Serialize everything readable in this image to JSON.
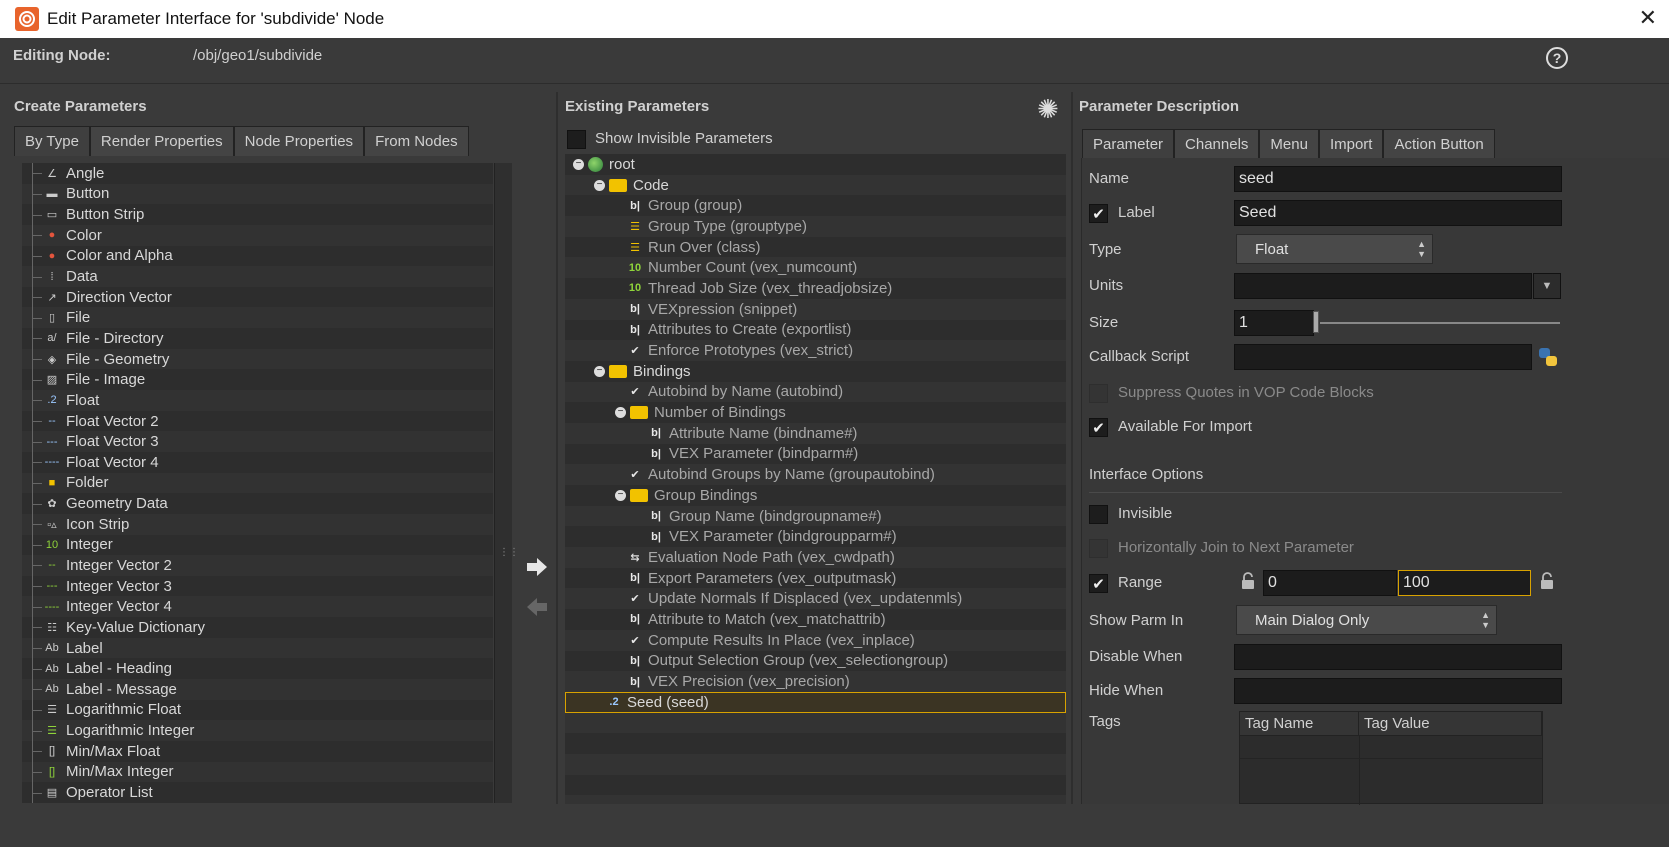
{
  "window": {
    "title": "Edit Parameter Interface for 'subdivide' Node"
  },
  "topbar": {
    "editing_label": "Editing Node:",
    "node_path": "/obj/geo1/subdivide"
  },
  "create": {
    "title": "Create Parameters",
    "tabs": [
      "By Type",
      "Render Properties",
      "Node Properties",
      "From Nodes"
    ],
    "items": [
      {
        "label": "Angle",
        "icon": "angle-icon"
      },
      {
        "label": "Button",
        "icon": "button-icon"
      },
      {
        "label": "Button Strip",
        "icon": "button-strip-icon"
      },
      {
        "label": "Color",
        "icon": "color-icon"
      },
      {
        "label": "Color and Alpha",
        "icon": "color-alpha-icon"
      },
      {
        "label": "Data",
        "icon": "data-icon"
      },
      {
        "label": "Direction Vector",
        "icon": "direction-icon"
      },
      {
        "label": "File",
        "icon": "file-icon"
      },
      {
        "label": "File - Directory",
        "icon": "directory-icon"
      },
      {
        "label": "File - Geometry",
        "icon": "geometry-file-icon"
      },
      {
        "label": "File - Image",
        "icon": "image-file-icon"
      },
      {
        "label": "Float",
        "icon": "float-icon"
      },
      {
        "label": "Float Vector 2",
        "icon": "vector2-icon"
      },
      {
        "label": "Float Vector 3",
        "icon": "vector3-icon"
      },
      {
        "label": "Float Vector 4",
        "icon": "vector4-icon"
      },
      {
        "label": "Folder",
        "icon": "folder-icon"
      },
      {
        "label": "Geometry Data",
        "icon": "geometry-data-icon"
      },
      {
        "label": "Icon Strip",
        "icon": "icon-strip-icon"
      },
      {
        "label": "Integer",
        "icon": "integer-icon"
      },
      {
        "label": "Integer Vector 2",
        "icon": "int-vector2-icon"
      },
      {
        "label": "Integer Vector 3",
        "icon": "int-vector3-icon"
      },
      {
        "label": "Integer Vector 4",
        "icon": "int-vector4-icon"
      },
      {
        "label": "Key-Value Dictionary",
        "icon": "dictionary-icon"
      },
      {
        "label": "Label",
        "icon": "label-icon"
      },
      {
        "label": "Label - Heading",
        "icon": "label-heading-icon"
      },
      {
        "label": "Label - Message",
        "icon": "label-message-icon"
      },
      {
        "label": "Logarithmic Float",
        "icon": "log-float-icon"
      },
      {
        "label": "Logarithmic Integer",
        "icon": "log-integer-icon"
      },
      {
        "label": "Min/Max Float",
        "icon": "minmax-float-icon"
      },
      {
        "label": "Min/Max Integer",
        "icon": "minmax-integer-icon"
      },
      {
        "label": "Operator List",
        "icon": "operator-list-icon"
      }
    ]
  },
  "existing": {
    "title": "Existing Parameters",
    "show_invisible": "Show Invisible Parameters",
    "rows": [
      {
        "label": "root",
        "depth": 0,
        "kind": "root"
      },
      {
        "label": "Code",
        "depth": 1,
        "kind": "folder"
      },
      {
        "label": "Group (group)",
        "depth": 2,
        "kind": "string"
      },
      {
        "label": "Group Type (grouptype)",
        "depth": 2,
        "kind": "menu"
      },
      {
        "label": "Run Over (class)",
        "depth": 2,
        "kind": "menu"
      },
      {
        "label": "Number Count (vex_numcount)",
        "depth": 2,
        "kind": "int"
      },
      {
        "label": "Thread Job Size (vex_threadjobsize)",
        "depth": 2,
        "kind": "int"
      },
      {
        "label": "VEXpression (snippet)",
        "depth": 2,
        "kind": "string"
      },
      {
        "label": "Attributes to Create (exportlist)",
        "depth": 2,
        "kind": "string"
      },
      {
        "label": "Enforce Prototypes (vex_strict)",
        "depth": 2,
        "kind": "toggle"
      },
      {
        "label": "Bindings",
        "depth": 1,
        "kind": "folder"
      },
      {
        "label": "Autobind by Name (autobind)",
        "depth": 2,
        "kind": "toggle"
      },
      {
        "label": "Number of Bindings",
        "depth": 2,
        "kind": "folder"
      },
      {
        "label": "Attribute Name (bindname#)",
        "depth": 3,
        "kind": "string"
      },
      {
        "label": "VEX Parameter (bindparm#)",
        "depth": 3,
        "kind": "string"
      },
      {
        "label": "Autobind Groups by Name (groupautobind)",
        "depth": 2,
        "kind": "toggle"
      },
      {
        "label": "Group Bindings",
        "depth": 2,
        "kind": "folder"
      },
      {
        "label": "Group Name (bindgroupname#)",
        "depth": 3,
        "kind": "string"
      },
      {
        "label": "VEX Parameter (bindgroupparm#)",
        "depth": 3,
        "kind": "string"
      },
      {
        "label": "Evaluation Node Path (vex_cwdpath)",
        "depth": 2,
        "kind": "oppath"
      },
      {
        "label": "Export Parameters (vex_outputmask)",
        "depth": 2,
        "kind": "string"
      },
      {
        "label": "Update Normals If Displaced (vex_updatenmls)",
        "depth": 2,
        "kind": "toggle"
      },
      {
        "label": "Attribute to Match (vex_matchattrib)",
        "depth": 2,
        "kind": "string"
      },
      {
        "label": "Compute Results In Place (vex_inplace)",
        "depth": 2,
        "kind": "toggle"
      },
      {
        "label": "Output Selection Group (vex_selectiongroup)",
        "depth": 2,
        "kind": "string"
      },
      {
        "label": "VEX Precision (vex_precision)",
        "depth": 2,
        "kind": "string"
      },
      {
        "label": "Seed (seed)",
        "depth": 1,
        "kind": "float",
        "selected": true
      },
      {
        "label": "",
        "depth": 0,
        "kind": "empty"
      },
      {
        "label": "",
        "depth": 0,
        "kind": "empty"
      },
      {
        "label": "",
        "depth": 0,
        "kind": "empty"
      },
      {
        "label": "",
        "depth": 0,
        "kind": "empty"
      },
      {
        "label": "",
        "depth": 0,
        "kind": "empty"
      }
    ]
  },
  "desc": {
    "title": "Parameter Description",
    "tabs": [
      "Parameter",
      "Channels",
      "Menu",
      "Import",
      "Action Button"
    ],
    "name_label": "Name",
    "name_value": "seed",
    "label_label": "Label",
    "label_value": "Seed",
    "type_label": "Type",
    "type_value": "Float",
    "units_label": "Units",
    "size_label": "Size",
    "size_value": "1",
    "callback_label": "Callback Script",
    "suppress_label": "Suppress Quotes in VOP Code Blocks",
    "available_label": "Available For Import",
    "interface_label": "Interface Options",
    "invisible_label": "Invisible",
    "join_label": "Horizontally Join to Next Parameter",
    "range_label": "Range",
    "range_min": "0",
    "range_max": "100",
    "show_in_label": "Show Parm In",
    "show_in_value": "Main Dialog Only",
    "disable_label": "Disable When",
    "hide_label": "Hide When",
    "tags_label": "Tags",
    "tag_name_header": "Tag Name",
    "tag_value_header": "Tag Value"
  },
  "colors": {
    "accent": "#d8a200",
    "folder": "#f2c200",
    "integer_icon": "#8fd43a"
  }
}
